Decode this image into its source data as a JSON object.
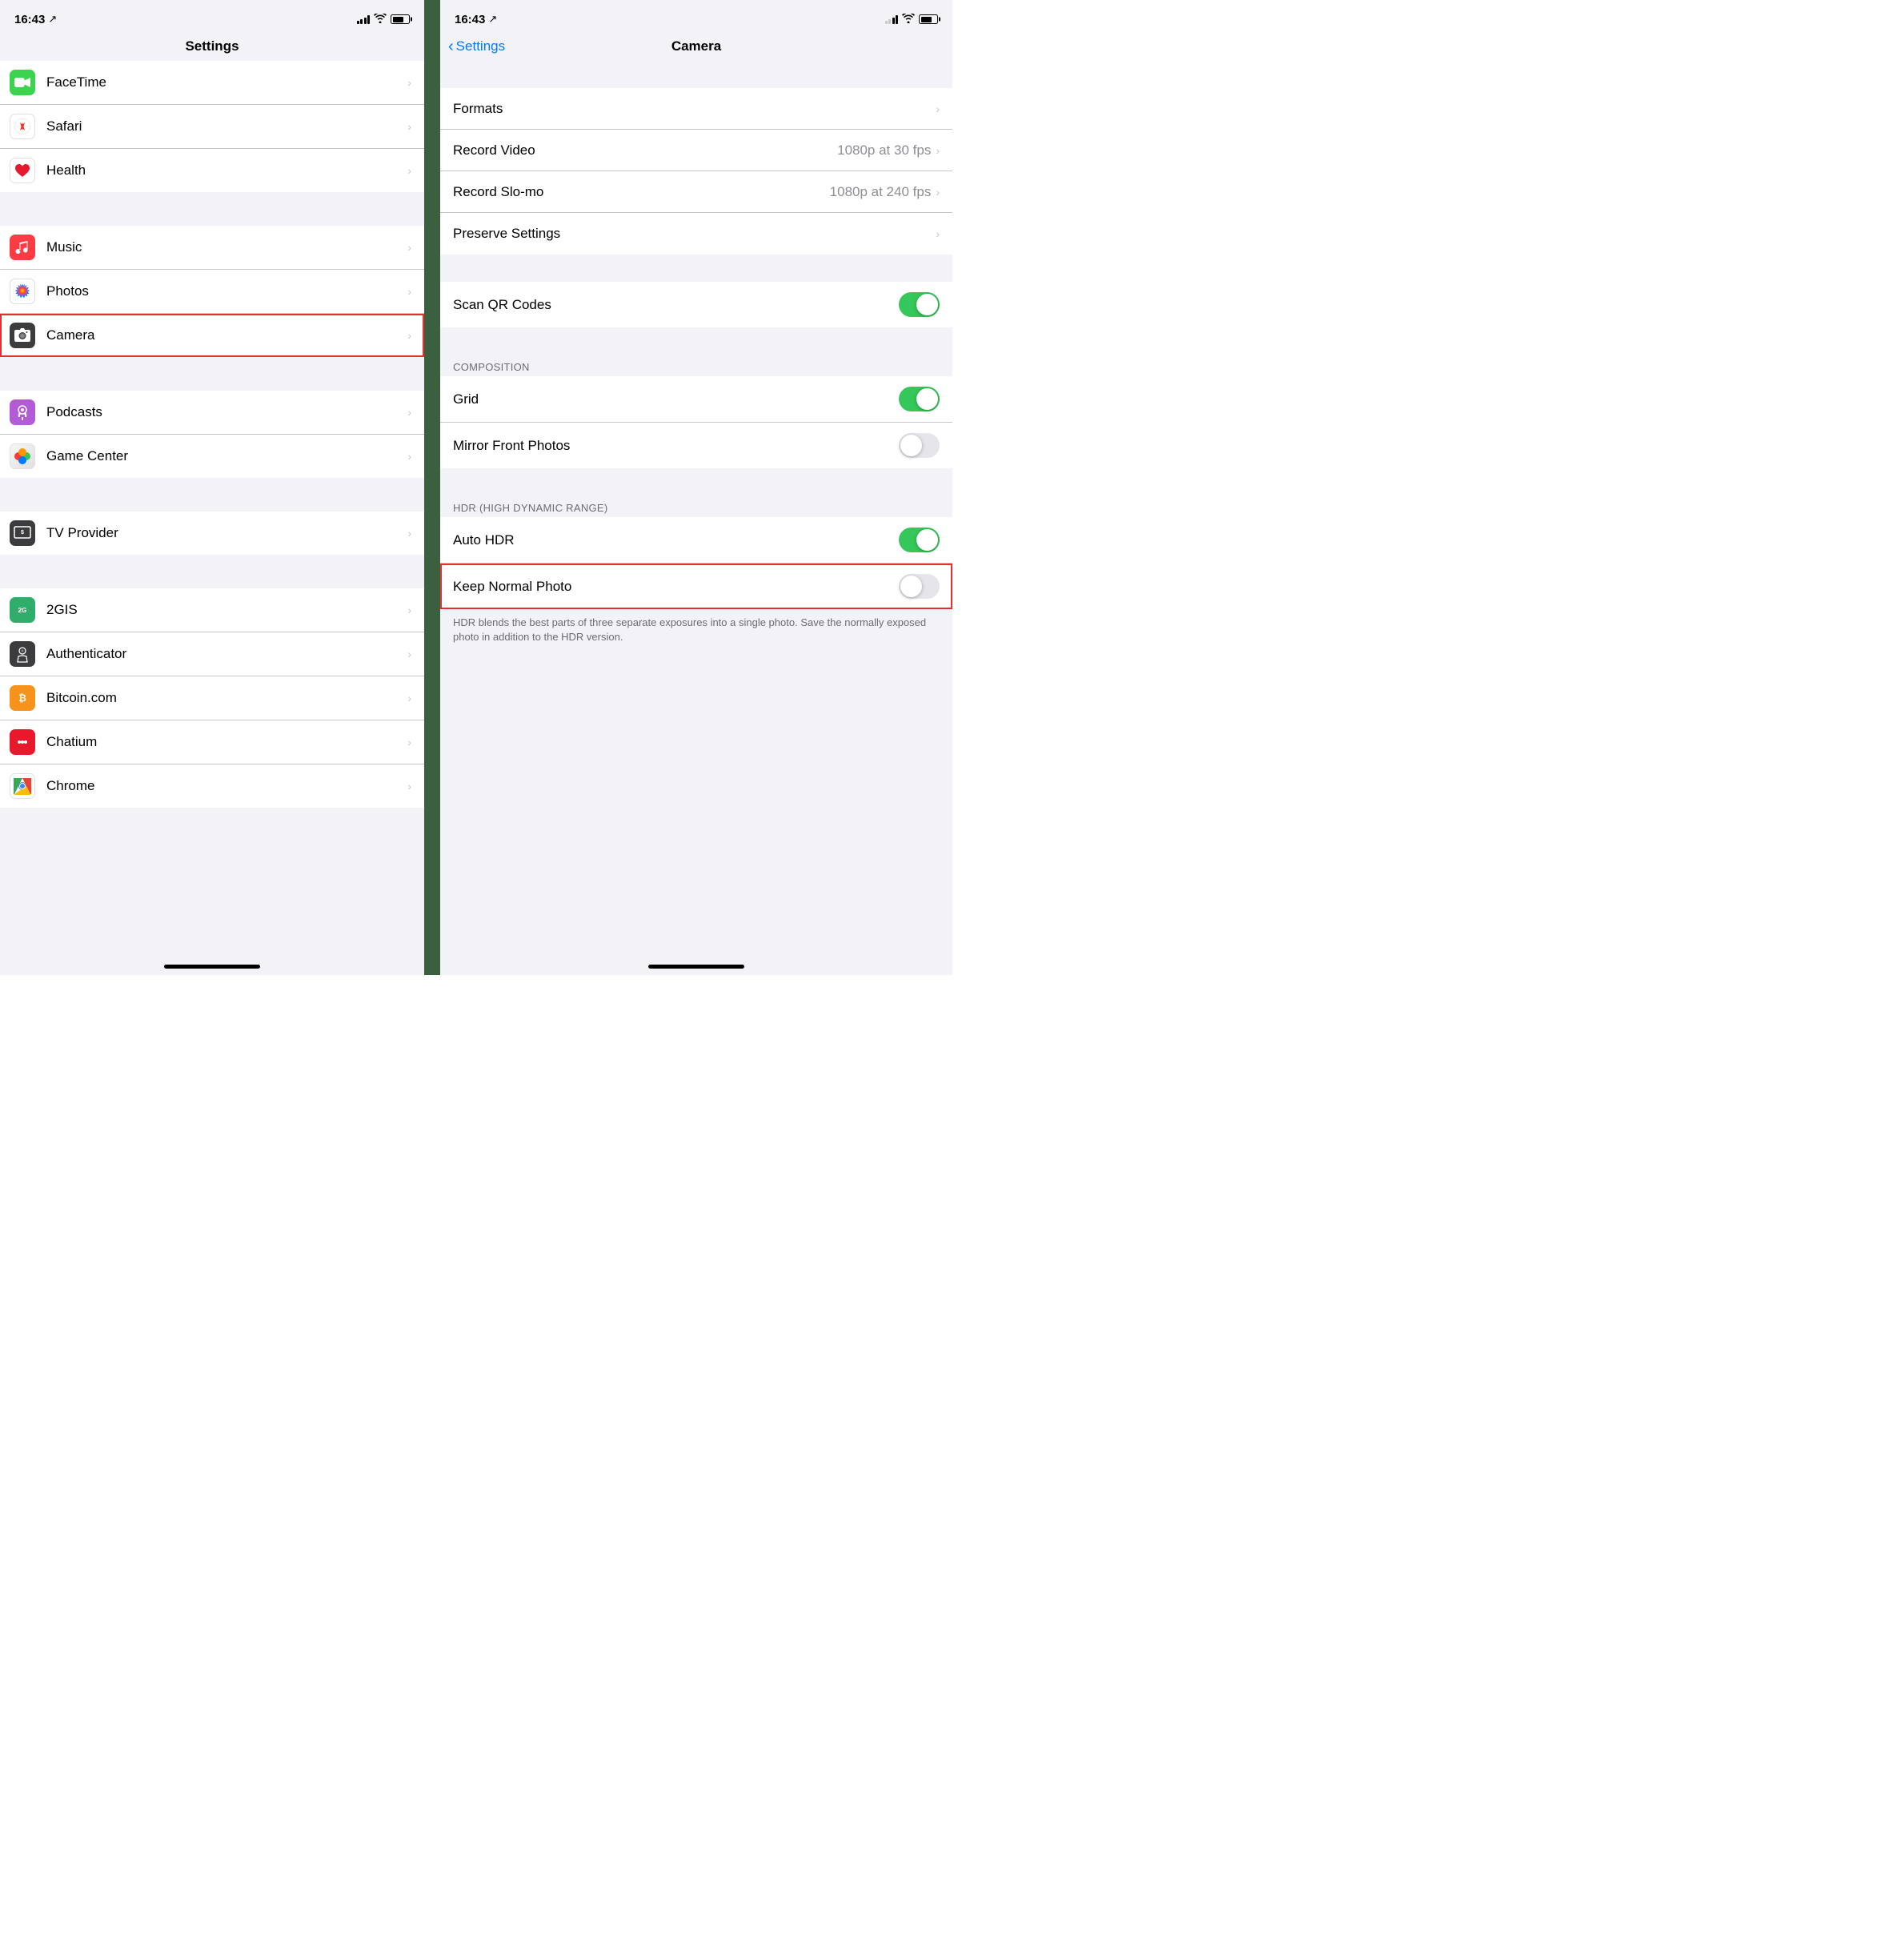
{
  "left": {
    "statusBar": {
      "time": "16:43",
      "location": "↗",
      "battery": 75
    },
    "title": "Settings",
    "groups": [
      {
        "items": [
          {
            "id": "facetime",
            "label": "FaceTime",
            "icon": "facetime"
          },
          {
            "id": "safari",
            "label": "Safari",
            "icon": "safari"
          },
          {
            "id": "health",
            "label": "Health",
            "icon": "health"
          }
        ]
      },
      {
        "items": [
          {
            "id": "music",
            "label": "Music",
            "icon": "music"
          },
          {
            "id": "photos",
            "label": "Photos",
            "icon": "photos"
          },
          {
            "id": "camera",
            "label": "Camera",
            "icon": "camera",
            "highlighted": true
          }
        ]
      },
      {
        "items": [
          {
            "id": "podcasts",
            "label": "Podcasts",
            "icon": "podcasts"
          },
          {
            "id": "gamecenter",
            "label": "Game Center",
            "icon": "gamecenter"
          }
        ]
      },
      {
        "items": [
          {
            "id": "tvprovider",
            "label": "TV Provider",
            "icon": "tvprovider"
          }
        ]
      },
      {
        "items": [
          {
            "id": "2gis",
            "label": "2GIS",
            "icon": "2gis"
          },
          {
            "id": "authenticator",
            "label": "Authenticator",
            "icon": "authenticator"
          },
          {
            "id": "bitcoin",
            "label": "Bitcoin.com",
            "icon": "bitcoin"
          },
          {
            "id": "chatium",
            "label": "Chatium",
            "icon": "chatium"
          },
          {
            "id": "chrome",
            "label": "Chrome",
            "icon": "chrome"
          }
        ]
      }
    ]
  },
  "right": {
    "statusBar": {
      "time": "16:43",
      "location": "↗"
    },
    "backLabel": "Settings",
    "title": "Camera",
    "groups": [
      {
        "items": [
          {
            "id": "formats",
            "label": "Formats",
            "value": "",
            "type": "chevron"
          },
          {
            "id": "record-video",
            "label": "Record Video",
            "value": "1080p at 30 fps",
            "type": "chevron"
          },
          {
            "id": "record-slomo",
            "label": "Record Slo-mo",
            "value": "1080p at 240 fps",
            "type": "chevron"
          },
          {
            "id": "preserve-settings",
            "label": "Preserve Settings",
            "value": "",
            "type": "chevron"
          }
        ]
      },
      {
        "items": [
          {
            "id": "scan-qr",
            "label": "Scan QR Codes",
            "value": "",
            "type": "toggle",
            "state": "on"
          }
        ]
      },
      {
        "sectionHeader": "COMPOSITION",
        "items": [
          {
            "id": "grid",
            "label": "Grid",
            "value": "",
            "type": "toggle",
            "state": "on"
          },
          {
            "id": "mirror-front-photos",
            "label": "Mirror Front Photos",
            "value": "",
            "type": "toggle",
            "state": "off"
          }
        ]
      },
      {
        "sectionHeader": "HDR (HIGH DYNAMIC RANGE)",
        "items": [
          {
            "id": "auto-hdr",
            "label": "Auto HDR",
            "value": "",
            "type": "toggle",
            "state": "on"
          },
          {
            "id": "keep-normal-photo",
            "label": "Keep Normal Photo",
            "value": "",
            "type": "toggle",
            "state": "off",
            "highlighted": true
          }
        ],
        "footer": "HDR blends the best parts of three separate exposures into a single photo. Save the normally exposed photo in addition to the HDR version."
      }
    ]
  },
  "icons": {
    "facetime_symbol": "📹",
    "safari_symbol": "🧭",
    "health_symbol": "❤️",
    "music_symbol": "🎵",
    "camera_symbol": "📷",
    "podcasts_symbol": "🎙",
    "gamecenter_symbol": "🎮",
    "tvprovider_symbol": "📺",
    "2gis_symbol": "🗺",
    "authenticator_symbol": "🔒",
    "bitcoin_symbol": "₿",
    "chatium_symbol": "💬",
    "chrome_symbol": "🌐"
  }
}
